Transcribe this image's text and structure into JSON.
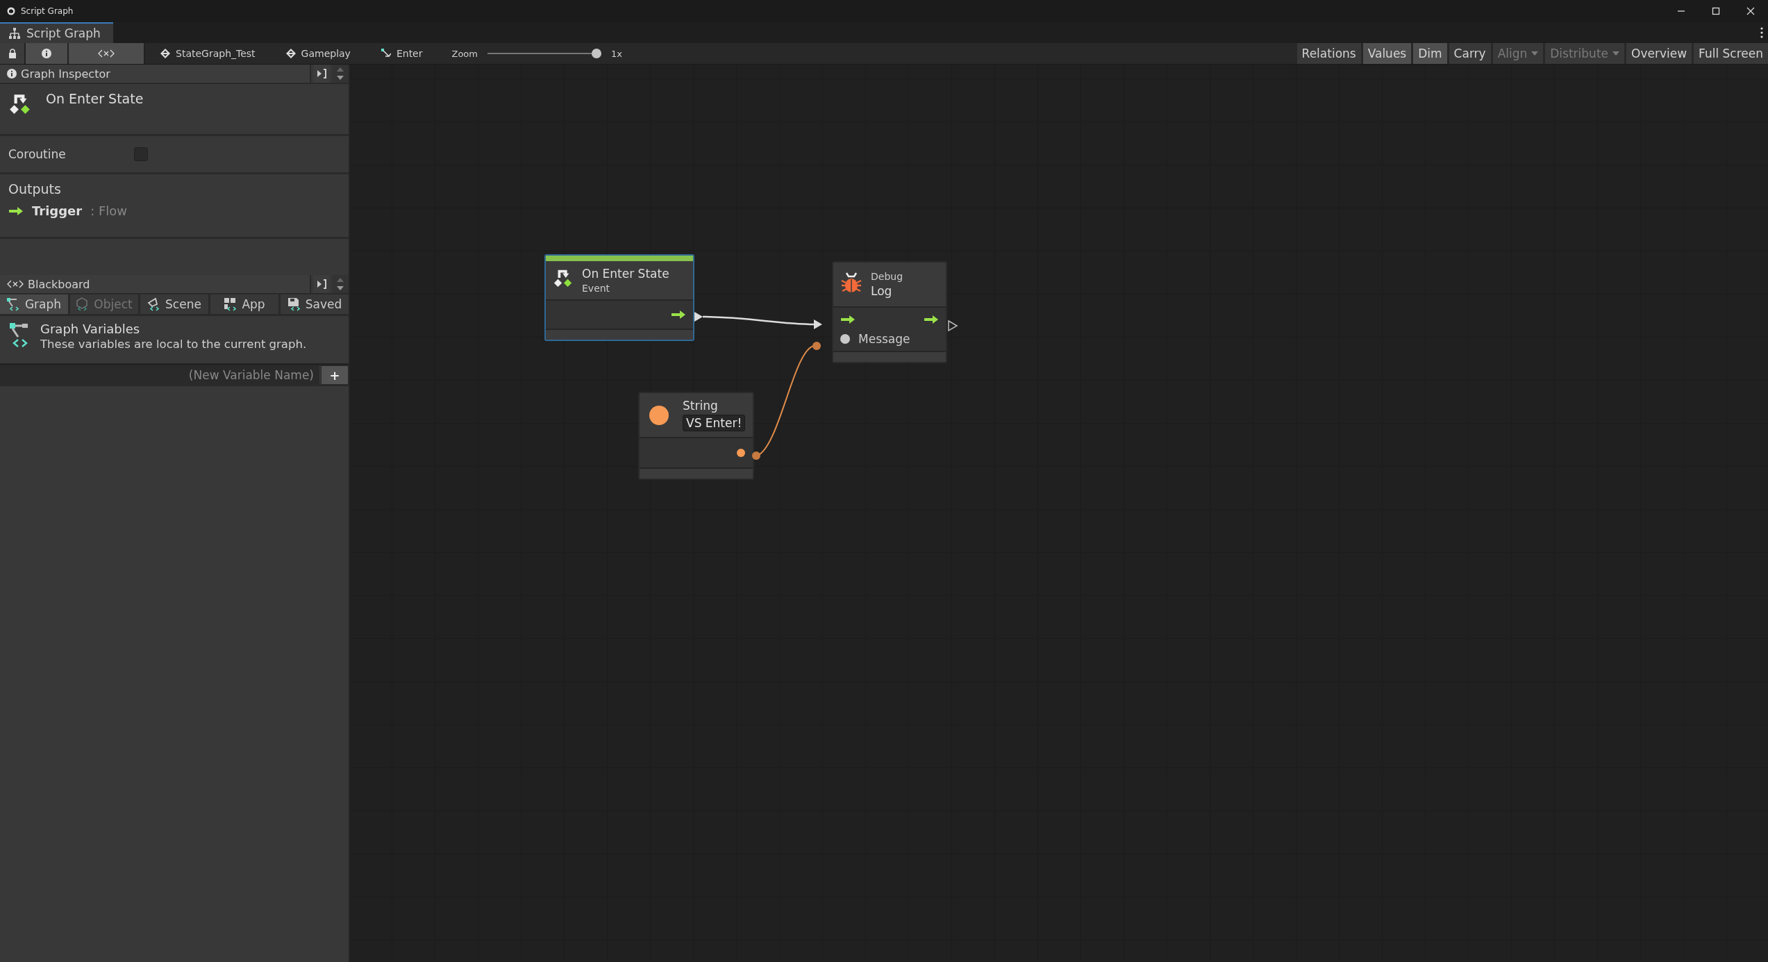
{
  "window": {
    "title": "Script Graph"
  },
  "tabs": [
    {
      "label": "Script Graph",
      "selected": true
    }
  ],
  "toolbar": {
    "panel_toggles": [
      {
        "kind": "lock",
        "selected": false
      },
      {
        "kind": "info",
        "selected": true
      },
      {
        "kind": "variables",
        "selected": true
      }
    ],
    "breadcrumbs": [
      {
        "kind": "graph",
        "label": "StateGraph_Test"
      },
      {
        "kind": "graph",
        "label": "Gameplay"
      },
      {
        "kind": "state",
        "label": "Enter"
      }
    ],
    "zoom": {
      "label": "Zoom",
      "level": 1,
      "reading": "1x"
    },
    "toggles": [
      {
        "kind": "toggle",
        "label": "Relations",
        "selected": false,
        "disabled": false
      },
      {
        "kind": "toggle",
        "label": "Values",
        "selected": true,
        "disabled": false
      },
      {
        "kind": "toggle",
        "label": "Dim",
        "selected": true,
        "disabled": false
      },
      {
        "kind": "toggle",
        "label": "Carry",
        "selected": false,
        "disabled": false
      },
      {
        "kind": "dropdown",
        "label": "Align",
        "selected": false,
        "disabled": true
      },
      {
        "kind": "dropdown",
        "label": "Distribute",
        "selected": false,
        "disabled": true
      },
      {
        "kind": "button",
        "label": "Overview",
        "selected": false,
        "disabled": false
      },
      {
        "kind": "button",
        "label": "Full Screen",
        "selected": false,
        "disabled": false
      }
    ]
  },
  "inspector": {
    "title": "Graph Inspector",
    "node_title": "On Enter State",
    "fields": [
      {
        "label": "Coroutine",
        "checked": false
      }
    ],
    "outputs_heading": "Outputs",
    "outputs": [
      {
        "name": "Trigger",
        "type": ": Flow"
      }
    ]
  },
  "blackboard": {
    "title": "Blackboard",
    "tabs": [
      {
        "kind": "graph",
        "label": "Graph",
        "selected": true,
        "disabled": false
      },
      {
        "kind": "object",
        "label": "Object",
        "selected": false,
        "disabled": true
      },
      {
        "kind": "scene",
        "label": "Scene",
        "selected": false,
        "disabled": false
      },
      {
        "kind": "app",
        "label": "App",
        "selected": false,
        "disabled": false
      },
      {
        "kind": "saved",
        "label": "Saved",
        "selected": false,
        "disabled": false
      }
    ],
    "heading": "Graph Variables",
    "description": "These variables are local to the current graph.",
    "new_variable": {
      "placeholder": "(New Variable Name)"
    },
    "add_label": "+"
  },
  "graph": {
    "nodes": [
      {
        "kind": "event",
        "title": "On Enter State",
        "subtitle": "Event",
        "selected": true
      },
      {
        "kind": "debug",
        "category": "Debug",
        "title": "Log",
        "ports": [
          {
            "label": "Message"
          }
        ],
        "selected": false
      },
      {
        "kind": "literal",
        "title": "String",
        "value": "VS Enter!",
        "selected": false
      }
    ]
  }
}
